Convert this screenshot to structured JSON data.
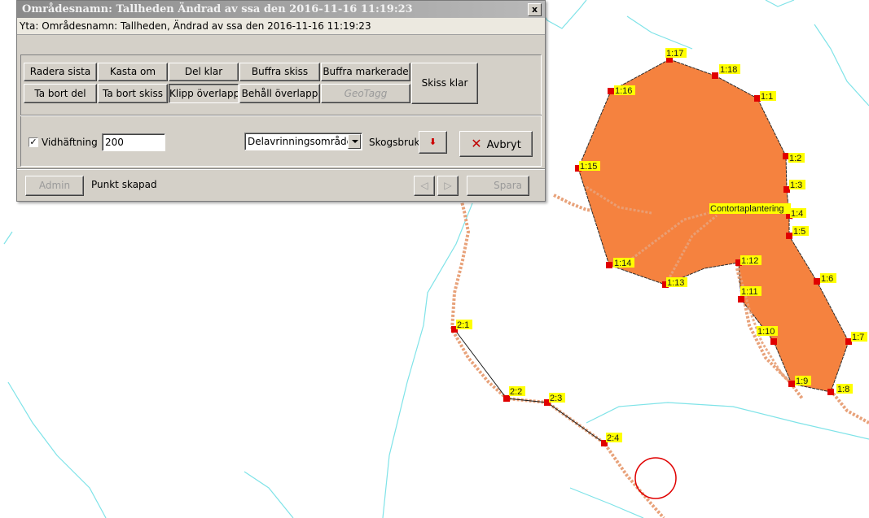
{
  "dialog": {
    "title": "Områdesnamn: Tallheden Ändrad av ssa den 2016-11-16 11:19:23",
    "close_label": "x",
    "info": "Yta: Områdesnamn: Tallheden, Ändrad av ssa den 2016-11-16 11:19:23",
    "buttons": {
      "radera_sista": "Radera sista",
      "kasta_om": "Kasta om",
      "del_klar": "Del klar",
      "buffra_skiss": "Buffra skiss",
      "buffra_markerade": "Buffra markerade",
      "skiss_klar": "Skiss klar",
      "ta_bort_del": "Ta bort del",
      "ta_bort_skiss": "Ta bort skiss",
      "klipp_overlapp": "Klipp överlapp",
      "behall_overlapp": "Behåll överlapp",
      "geotagg": "GeoTagg"
    },
    "snapping": {
      "label": "Vidhäftning",
      "checked": true,
      "value": "200"
    },
    "area_select": {
      "selected": "Delavrinningsområde"
    },
    "skogsbruk_label": "Skogsbruk (S)",
    "avbryt_label": "Avbryt",
    "admin_label": "Admin",
    "status": "Punkt skapad",
    "spara_label": "Spara"
  },
  "map": {
    "colors": {
      "polygon_fill": "#f5823f",
      "vertex": "#e00000",
      "label_bg": "#ffff00",
      "stream": "#7fe3e8",
      "road": "#e8a27a",
      "circle": "#e00000"
    },
    "area_label": "Contortaplantering",
    "vertex_labels": [
      "1:1",
      "1:2",
      "1:3",
      "1:4",
      "1:5",
      "1:6",
      "1:7",
      "1:8",
      "1:9",
      "1:10",
      "1:11",
      "1:12",
      "1:13",
      "1:14",
      "1:15",
      "1:16",
      "1:17",
      "1:18",
      "2:1",
      "2:2",
      "2:3",
      "2:4"
    ]
  }
}
